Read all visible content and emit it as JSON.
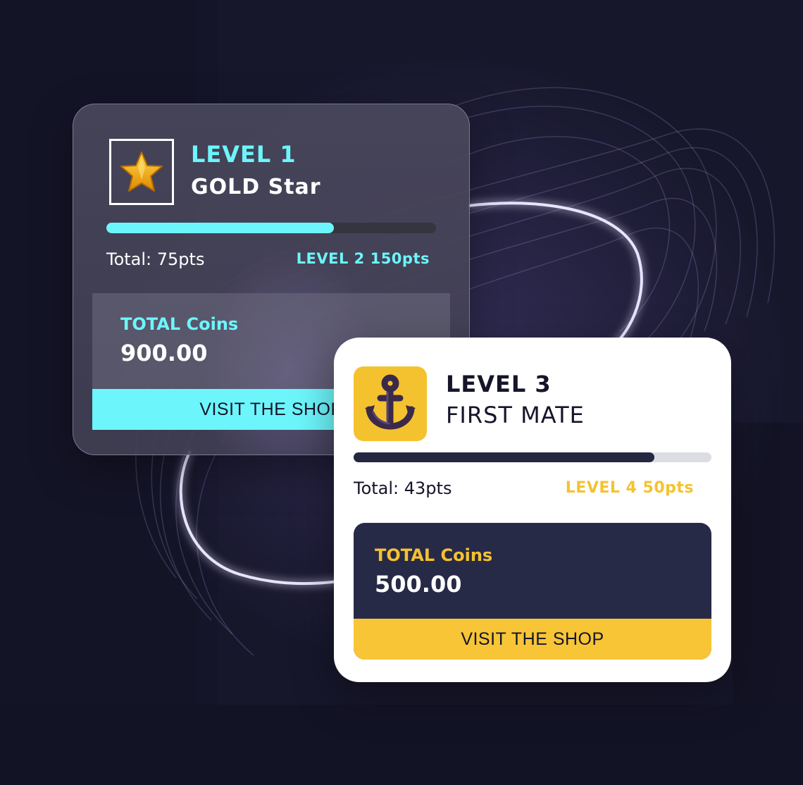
{
  "colors": {
    "background": "#15152a",
    "cyan_accent": "#6cf6fb",
    "gold_accent": "#f5c22f",
    "navy": "#272a47"
  },
  "cards": [
    {
      "badge_icon": "gold-star-icon",
      "level": "LEVEL 1",
      "title": "GOLD Star",
      "progress_fraction": 0.69,
      "total": "Total: 75pts",
      "next_level": "LEVEL 2 150pts",
      "coins_label": "TOTAL Coins",
      "coins_value": "900.00",
      "shop_button": "VISIT THE SHOP"
    },
    {
      "badge_icon": "anchor-icon",
      "level": "LEVEL 3",
      "title": "FIRST MATE",
      "progress_fraction": 0.84,
      "total": "Total: 43pts",
      "next_level": "LEVEL 4 50pts",
      "coins_label": "TOTAL Coins",
      "coins_value": "500.00",
      "shop_button": "VISIT THE SHOP"
    }
  ]
}
